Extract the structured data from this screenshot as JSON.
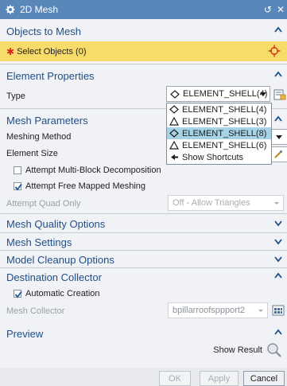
{
  "window": {
    "title": "2D Mesh",
    "reset_glyph": "↺",
    "close_glyph": "✕"
  },
  "sections": {
    "objects_to_mesh": "Objects to Mesh",
    "element_properties": "Element Properties",
    "mesh_parameters": "Mesh Parameters",
    "mesh_quality": "Mesh Quality Options",
    "mesh_settings": "Mesh Settings",
    "model_cleanup": "Model Cleanup Options",
    "destination_collector": "Destination Collector",
    "preview": "Preview"
  },
  "objects": {
    "required_marker": "✱",
    "select_label": "Select Objects (0)"
  },
  "element": {
    "type_label": "Type",
    "type_value": "ELEMENT_SHELL(4)",
    "options": [
      {
        "label": "ELEMENT_SHELL(4)",
        "icon": "quad-diamond-icon",
        "highlighted": false
      },
      {
        "label": "ELEMENT_SHELL(3)",
        "icon": "triangle-icon",
        "highlighted": false
      },
      {
        "label": "ELEMENT_SHELL(8)",
        "icon": "quad-diamond-icon",
        "highlighted": true
      },
      {
        "label": "ELEMENT_SHELL(6)",
        "icon": "triangle-icon",
        "highlighted": false
      },
      {
        "label": "Show Shortcuts",
        "icon": "shortcut-icon",
        "highlighted": false
      }
    ]
  },
  "mesh_params": {
    "method_label": "Meshing Method",
    "size_label": "Element Size",
    "multi_block": {
      "label": "Attempt Multi-Block Decomposition",
      "checked": false
    },
    "free_mapped": {
      "label": "Attempt Free Mapped Meshing",
      "checked": true
    },
    "quad_only_label": "Attempt Quad Only",
    "quad_only_value": "Off - Allow Triangles"
  },
  "destination": {
    "auto_creation": {
      "label": "Automatic Creation",
      "checked": true
    },
    "collector_label": "Mesh Collector",
    "collector_value": "bpillarroofspрport2"
  },
  "preview": {
    "show_result_label": "Show Result"
  },
  "buttons": {
    "ok": "OK",
    "apply": "Apply",
    "cancel": "Cancel"
  },
  "colors": {
    "title_bar": "#5a87b9",
    "section_header": "#1f4e86",
    "selection_highlight": "#f8dc6a",
    "required": "#e0231c",
    "dropdown_highlight": "#a6d3e6"
  }
}
